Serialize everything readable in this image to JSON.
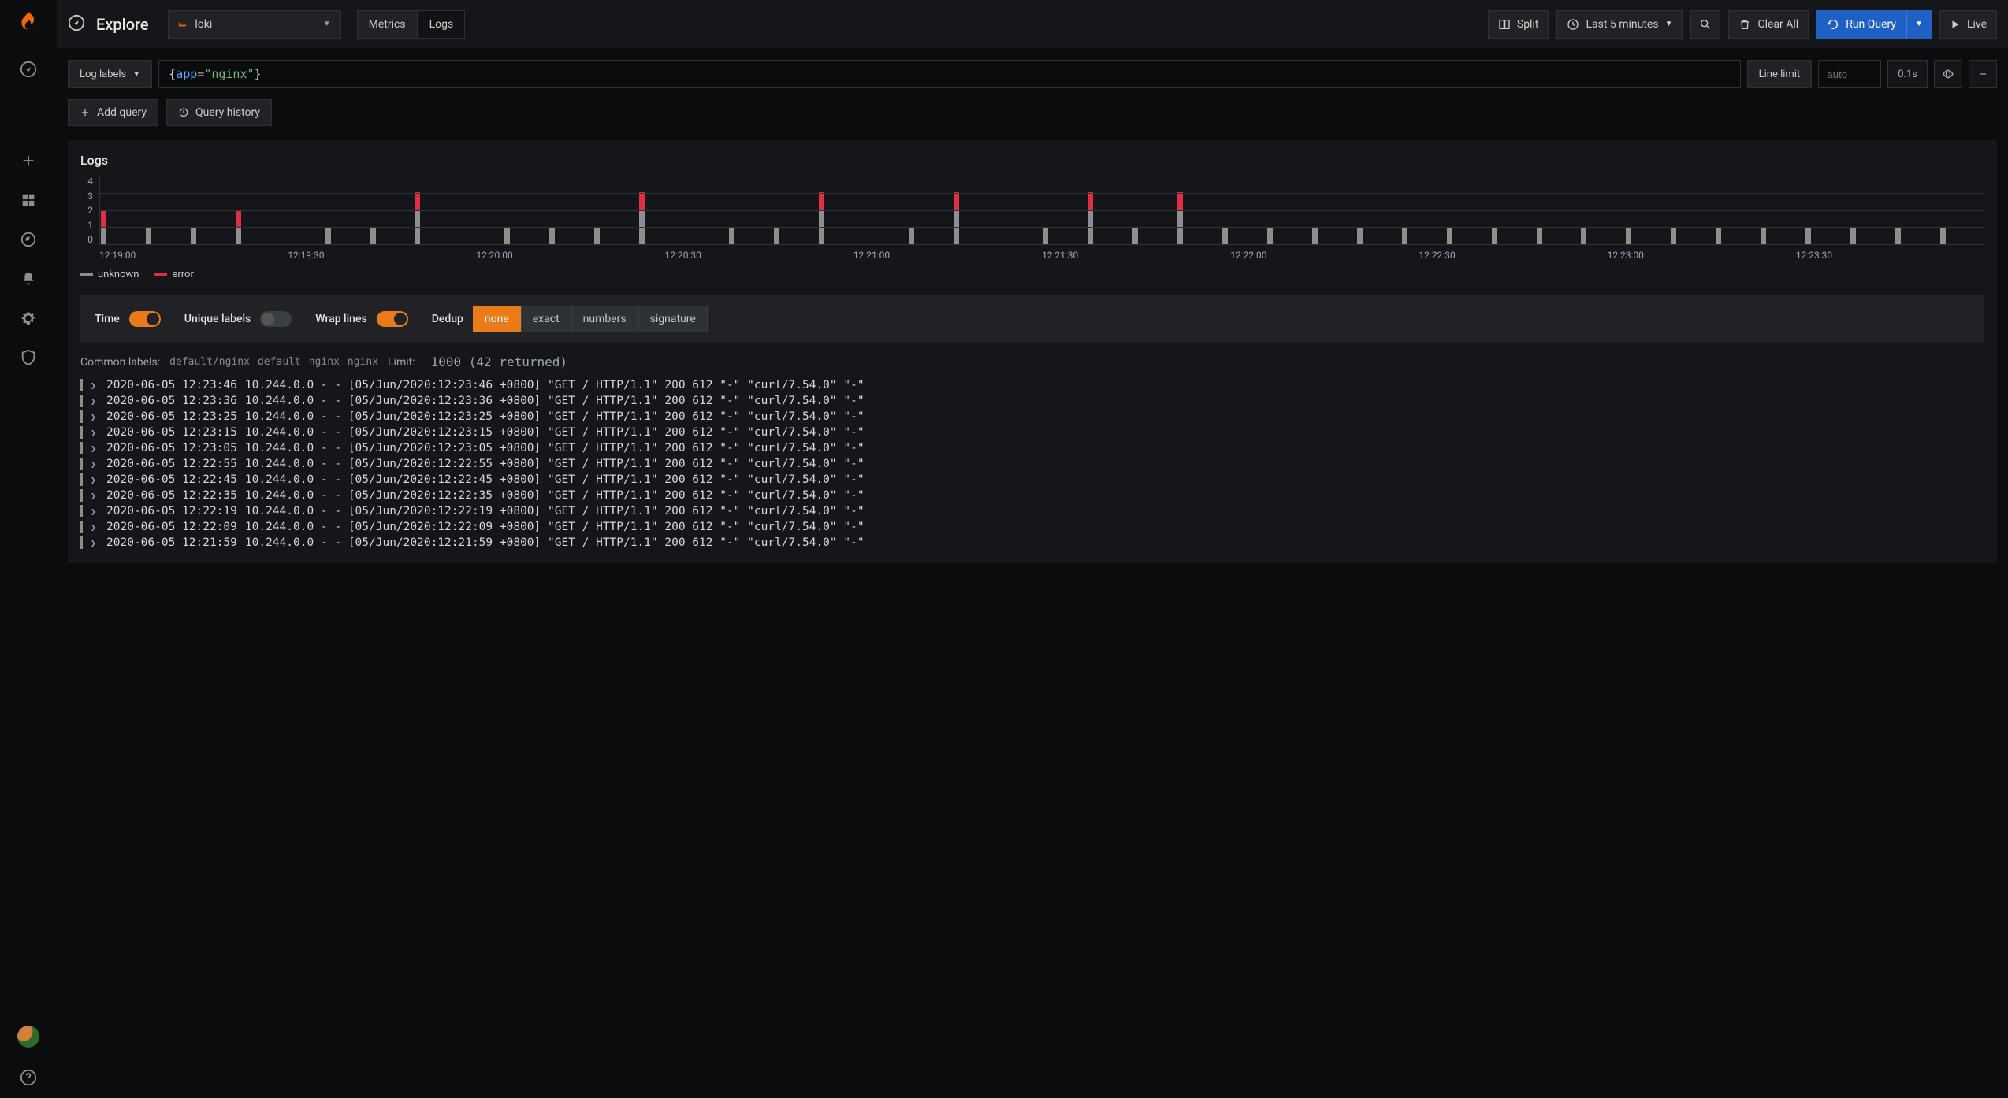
{
  "sidenav": {
    "items": [
      "add",
      "dashboards",
      "explore",
      "alerting",
      "configuration",
      "shield"
    ]
  },
  "topbar": {
    "title": "Explore",
    "datasource": "loki",
    "tabs": {
      "metrics": "Metrics",
      "logs": "Logs",
      "active": "logs"
    },
    "split": "Split",
    "timerange": "Last 5 minutes",
    "clear": "Clear All",
    "run": "Run Query",
    "live": "Live"
  },
  "query": {
    "labelsBtn": "Log labels",
    "brace_open": "{",
    "key": "app",
    "op": "=",
    "str": "\"nginx\"",
    "brace_close": "}",
    "lineLimitLabel": "Line limit",
    "lineLimitPlaceholder": "auto",
    "timing": "0.1s"
  },
  "actions": {
    "addQuery": "Add query",
    "history": "Query history"
  },
  "panel": {
    "title": "Logs"
  },
  "chart_data": {
    "type": "bar",
    "ylabel": "",
    "yticks": [
      "4",
      "3",
      "2",
      "1",
      "0"
    ],
    "ymax": 4,
    "categories": [
      "12:19:00",
      "12:19:30",
      "12:20:00",
      "12:20:30",
      "12:21:00",
      "12:21:30",
      "12:22:00",
      "12:22:30",
      "12:23:00",
      "12:23:30"
    ],
    "series_names": [
      "unknown",
      "error"
    ],
    "bars": [
      {
        "u": 1,
        "e": 1
      },
      {
        "u": 1,
        "e": 0
      },
      {
        "u": 1,
        "e": 0
      },
      {
        "u": 1,
        "e": 1
      },
      {
        "u": 0,
        "e": 0
      },
      {
        "u": 1,
        "e": 0
      },
      {
        "u": 1,
        "e": 0
      },
      {
        "u": 2,
        "e": 1
      },
      {
        "u": 0,
        "e": 0
      },
      {
        "u": 1,
        "e": 0
      },
      {
        "u": 1,
        "e": 0
      },
      {
        "u": 1,
        "e": 0
      },
      {
        "u": 2,
        "e": 1
      },
      {
        "u": 0,
        "e": 0
      },
      {
        "u": 1,
        "e": 0
      },
      {
        "u": 1,
        "e": 0
      },
      {
        "u": 2,
        "e": 1
      },
      {
        "u": 0,
        "e": 0
      },
      {
        "u": 1,
        "e": 0
      },
      {
        "u": 2,
        "e": 1
      },
      {
        "u": 0,
        "e": 0
      },
      {
        "u": 1,
        "e": 0
      },
      {
        "u": 2,
        "e": 1
      },
      {
        "u": 1,
        "e": 0
      },
      {
        "u": 2,
        "e": 1
      },
      {
        "u": 1,
        "e": 0
      },
      {
        "u": 1,
        "e": 0
      },
      {
        "u": 1,
        "e": 0
      },
      {
        "u": 1,
        "e": 0
      },
      {
        "u": 1,
        "e": 0
      },
      {
        "u": 1,
        "e": 0
      },
      {
        "u": 1,
        "e": 0
      },
      {
        "u": 1,
        "e": 0
      },
      {
        "u": 1,
        "e": 0
      },
      {
        "u": 1,
        "e": 0
      },
      {
        "u": 1,
        "e": 0
      },
      {
        "u": 1,
        "e": 0
      },
      {
        "u": 1,
        "e": 0
      },
      {
        "u": 1,
        "e": 0
      },
      {
        "u": 1,
        "e": 0
      },
      {
        "u": 1,
        "e": 0
      },
      {
        "u": 1,
        "e": 0
      }
    ],
    "legend": {
      "unknown": "unknown",
      "error": "error"
    }
  },
  "options": {
    "time": "Time",
    "unique": "Unique labels",
    "wrap": "Wrap lines",
    "dedup": "Dedup",
    "dedupOptions": [
      "none",
      "exact",
      "numbers",
      "signature"
    ],
    "dedupActive": "none"
  },
  "results": {
    "commonLabelsTitle": "Common labels:",
    "commonLabels": [
      "default/nginx",
      "default",
      "nginx",
      "nginx"
    ],
    "limitLabel": "Limit:",
    "limitValue": "1000 (42 returned)"
  },
  "logs": [
    {
      "ts": "2020-06-05 12:23:46",
      "msg": "10.244.0.0 - - [05/Jun/2020:12:23:46 +0800] \"GET / HTTP/1.1\" 200 612 \"-\" \"curl/7.54.0\" \"-\""
    },
    {
      "ts": "2020-06-05 12:23:36",
      "msg": "10.244.0.0 - - [05/Jun/2020:12:23:36 +0800] \"GET / HTTP/1.1\" 200 612 \"-\" \"curl/7.54.0\" \"-\""
    },
    {
      "ts": "2020-06-05 12:23:25",
      "msg": "10.244.0.0 - - [05/Jun/2020:12:23:25 +0800] \"GET / HTTP/1.1\" 200 612 \"-\" \"curl/7.54.0\" \"-\""
    },
    {
      "ts": "2020-06-05 12:23:15",
      "msg": "10.244.0.0 - - [05/Jun/2020:12:23:15 +0800] \"GET / HTTP/1.1\" 200 612 \"-\" \"curl/7.54.0\" \"-\""
    },
    {
      "ts": "2020-06-05 12:23:05",
      "msg": "10.244.0.0 - - [05/Jun/2020:12:23:05 +0800] \"GET / HTTP/1.1\" 200 612 \"-\" \"curl/7.54.0\" \"-\""
    },
    {
      "ts": "2020-06-05 12:22:55",
      "msg": "10.244.0.0 - - [05/Jun/2020:12:22:55 +0800] \"GET / HTTP/1.1\" 200 612 \"-\" \"curl/7.54.0\" \"-\""
    },
    {
      "ts": "2020-06-05 12:22:45",
      "msg": "10.244.0.0 - - [05/Jun/2020:12:22:45 +0800] \"GET / HTTP/1.1\" 200 612 \"-\" \"curl/7.54.0\" \"-\""
    },
    {
      "ts": "2020-06-05 12:22:35",
      "msg": "10.244.0.0 - - [05/Jun/2020:12:22:35 +0800] \"GET / HTTP/1.1\" 200 612 \"-\" \"curl/7.54.0\" \"-\""
    },
    {
      "ts": "2020-06-05 12:22:19",
      "msg": "10.244.0.0 - - [05/Jun/2020:12:22:19 +0800] \"GET / HTTP/1.1\" 200 612 \"-\" \"curl/7.54.0\" \"-\""
    },
    {
      "ts": "2020-06-05 12:22:09",
      "msg": "10.244.0.0 - - [05/Jun/2020:12:22:09 +0800] \"GET / HTTP/1.1\" 200 612 \"-\" \"curl/7.54.0\" \"-\""
    },
    {
      "ts": "2020-06-05 12:21:59",
      "msg": "10.244.0.0 - - [05/Jun/2020:12:21:59 +0800] \"GET / HTTP/1.1\" 200 612 \"-\" \"curl/7.54.0\" \"-\""
    }
  ]
}
